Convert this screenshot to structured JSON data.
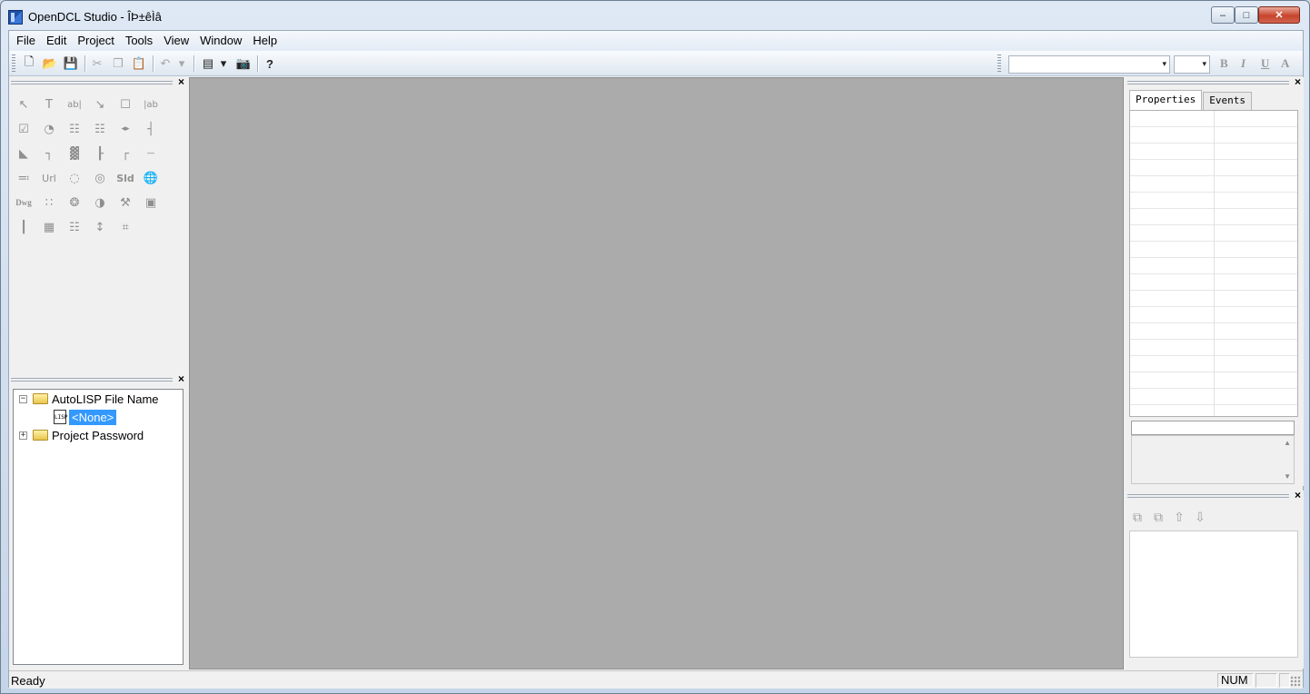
{
  "window": {
    "title": "OpenDCL Studio - ÎÞ±êÌâ",
    "min_glyph": "–",
    "max_glyph": "□",
    "close_glyph": "✕"
  },
  "menu": [
    "File",
    "Edit",
    "Project",
    "Tools",
    "View",
    "Window",
    "Help"
  ],
  "toolbar": {
    "new_glyph": "🗋",
    "open_glyph": "📂",
    "save_glyph": "💾",
    "cut_glyph": "✂",
    "copy_glyph": "❐",
    "paste_glyph": "📋",
    "undo_glyph": "↶",
    "dropdown_glyph": "▾",
    "form_glyph": "▤",
    "camera_glyph": "📷",
    "help_glyph": "?",
    "font_value": "",
    "size_value": "",
    "bold": "B",
    "italic": "I",
    "underline": "U",
    "color": "A"
  },
  "close_glyph": "×",
  "tools": [
    "↖",
    "T",
    "ab|",
    "↘",
    "☐",
    "|ab",
    "☑",
    "◔",
    "☷",
    "☷",
    "◂▸",
    "┤",
    "◣",
    "┐",
    "▓",
    "┠",
    "┌",
    "┈",
    "≕",
    "Url",
    "◌",
    "◎",
    "Sld",
    "🌐",
    "Dwg",
    "∷",
    "❂",
    "◑",
    "⚒",
    "▣",
    "┃",
    "▦",
    "☷",
    "↕",
    "⌗"
  ],
  "project_tree": {
    "items": [
      {
        "label": "AutoLISP File Name",
        "expander": "−"
      },
      {
        "label": "<None>",
        "icon_text": "LISP"
      },
      {
        "label": "Project Password",
        "expander": "+"
      }
    ]
  },
  "properties": {
    "tabs": [
      "Properties",
      "Events"
    ],
    "desc_up": "▲",
    "desc_down": "▼"
  },
  "layer_buttons": [
    "⧉",
    "⧉",
    "⇧",
    "⇩"
  ],
  "status": {
    "text": "Ready",
    "num": "NUM",
    "cell2": "",
    "cell3": ""
  }
}
